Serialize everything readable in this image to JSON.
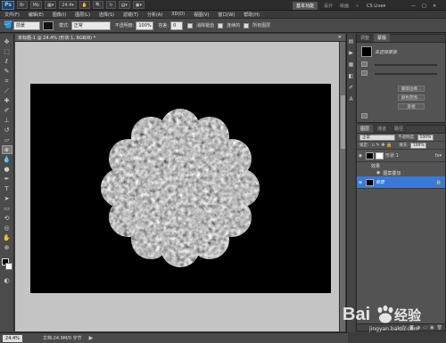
{
  "topbar": {
    "logo": "Ps",
    "zoom": "24.4",
    "workspace": "基本功能",
    "cs_live": "CS Live"
  },
  "menu": [
    "文件(F)",
    "编辑(E)",
    "图像(I)",
    "图层(L)",
    "选择(S)",
    "滤镜(T)",
    "分析(A)",
    "3D(D)",
    "视图(V)",
    "窗口(W)",
    "帮助(H)"
  ],
  "options": {
    "mode_label": "模式:",
    "mode_value": "正常",
    "opacity_label": "不透明度:",
    "opacity_value": "100%",
    "feather_label": "容差:",
    "feather_value": "0",
    "antialias_label": "消除锯齿",
    "contiguous_label": "连续的",
    "alllayers_label": "所有图层",
    "preset": "前景"
  },
  "doc_tab": "未标题-1 @ 24.4% (形状 1, RGB/8) *",
  "status": {
    "zoom": "24.4%",
    "doc_info": "文档:24.9M/0 字节"
  },
  "masks_panel": {
    "tabs": [
      "调整",
      "蒙版"
    ],
    "label": "未选择蒙版",
    "buttons": [
      "蒙版边缘...",
      "颜色范围...",
      "反相"
    ]
  },
  "layers_panel": {
    "tabs": [
      "图层",
      "通道",
      "路径"
    ],
    "blend_mode": "正常",
    "opacity_label": "不透明度:",
    "opacity_value": "100%",
    "lock_label": "锁定:",
    "fill_label": "填充:",
    "fill_value": "100%",
    "layers": [
      {
        "name": "形状 1",
        "selected": false
      },
      {
        "name": "效果",
        "selected": false,
        "effect": true
      },
      {
        "name": "图案叠加",
        "selected": false,
        "effect": true
      },
      {
        "name": "背景",
        "selected": true
      }
    ]
  },
  "watermark": {
    "brand": "Bai",
    "brand2": "经验",
    "url": "jingyan.baidu.com"
  },
  "colors": {
    "canvas_bg": "#c4c4c4",
    "document": "#000000",
    "selection": "#3879d9"
  }
}
